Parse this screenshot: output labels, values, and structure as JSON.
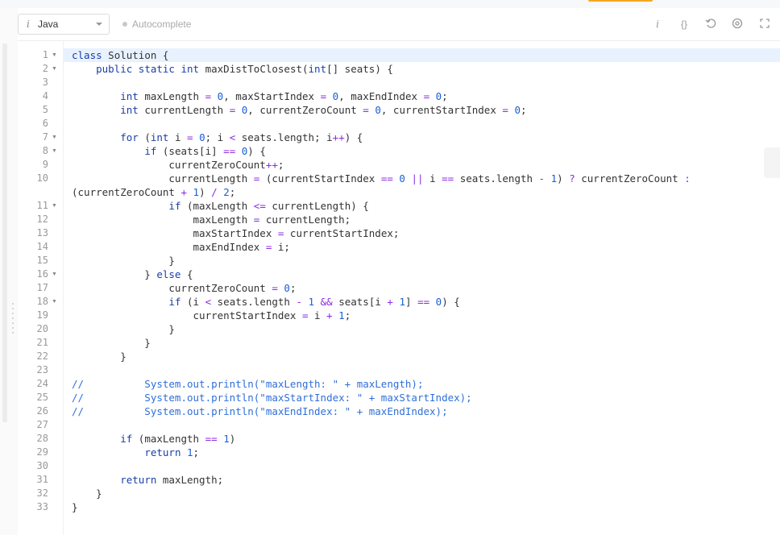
{
  "toolbar": {
    "language": "Java",
    "autocomplete_label": "Autocomplete",
    "icons": [
      "info-icon",
      "braces-icon",
      "undo-icon",
      "settings-icon",
      "fullscreen-icon"
    ]
  },
  "editor": {
    "active_line": 1,
    "lines": [
      {
        "n": "1",
        "fold": true,
        "text": "class Solution {"
      },
      {
        "n": "2",
        "fold": true,
        "text": "    public static int maxDistToClosest(int[] seats) {"
      },
      {
        "n": "3",
        "fold": false,
        "text": ""
      },
      {
        "n": "4",
        "fold": false,
        "text": "        int maxLength = 0, maxStartIndex = 0, maxEndIndex = 0;"
      },
      {
        "n": "5",
        "fold": false,
        "text": "        int currentLength = 0, currentZeroCount = 0, currentStartIndex = 0;"
      },
      {
        "n": "6",
        "fold": false,
        "text": ""
      },
      {
        "n": "7",
        "fold": true,
        "text": "        for (int i = 0; i < seats.length; i++) {"
      },
      {
        "n": "8",
        "fold": true,
        "text": "            if (seats[i] == 0) {"
      },
      {
        "n": "9",
        "fold": false,
        "text": "                currentZeroCount++;"
      },
      {
        "n": "10",
        "fold": false,
        "text": "                currentLength = (currentStartIndex == 0 || i == seats.length - 1) ? currentZeroCount :"
      },
      {
        "n": "",
        "fold": false,
        "text": "(currentZeroCount + 1) / 2;"
      },
      {
        "n": "11",
        "fold": true,
        "text": "                if (maxLength <= currentLength) {"
      },
      {
        "n": "12",
        "fold": false,
        "text": "                    maxLength = currentLength;"
      },
      {
        "n": "13",
        "fold": false,
        "text": "                    maxStartIndex = currentStartIndex;"
      },
      {
        "n": "14",
        "fold": false,
        "text": "                    maxEndIndex = i;"
      },
      {
        "n": "15",
        "fold": false,
        "text": "                }"
      },
      {
        "n": "16",
        "fold": true,
        "text": "            } else {"
      },
      {
        "n": "17",
        "fold": false,
        "text": "                currentZeroCount = 0;"
      },
      {
        "n": "18",
        "fold": true,
        "text": "                if (i < seats.length - 1 && seats[i + 1] == 0) {"
      },
      {
        "n": "19",
        "fold": false,
        "text": "                    currentStartIndex = i + 1;"
      },
      {
        "n": "20",
        "fold": false,
        "text": "                }"
      },
      {
        "n": "21",
        "fold": false,
        "text": "            }"
      },
      {
        "n": "22",
        "fold": false,
        "text": "        }"
      },
      {
        "n": "23",
        "fold": false,
        "text": ""
      },
      {
        "n": "24",
        "fold": false,
        "text": "//          System.out.println(\"maxLength: \" + maxLength);"
      },
      {
        "n": "25",
        "fold": false,
        "text": "//          System.out.println(\"maxStartIndex: \" + maxStartIndex);"
      },
      {
        "n": "26",
        "fold": false,
        "text": "//          System.out.println(\"maxEndIndex: \" + maxEndIndex);"
      },
      {
        "n": "27",
        "fold": false,
        "text": ""
      },
      {
        "n": "28",
        "fold": false,
        "text": "        if (maxLength == 1)"
      },
      {
        "n": "29",
        "fold": false,
        "text": "            return 1;"
      },
      {
        "n": "30",
        "fold": false,
        "text": ""
      },
      {
        "n": "31",
        "fold": false,
        "text": "        return maxLength;"
      },
      {
        "n": "32",
        "fold": false,
        "text": "    }"
      },
      {
        "n": "33",
        "fold": false,
        "text": "}"
      }
    ]
  }
}
